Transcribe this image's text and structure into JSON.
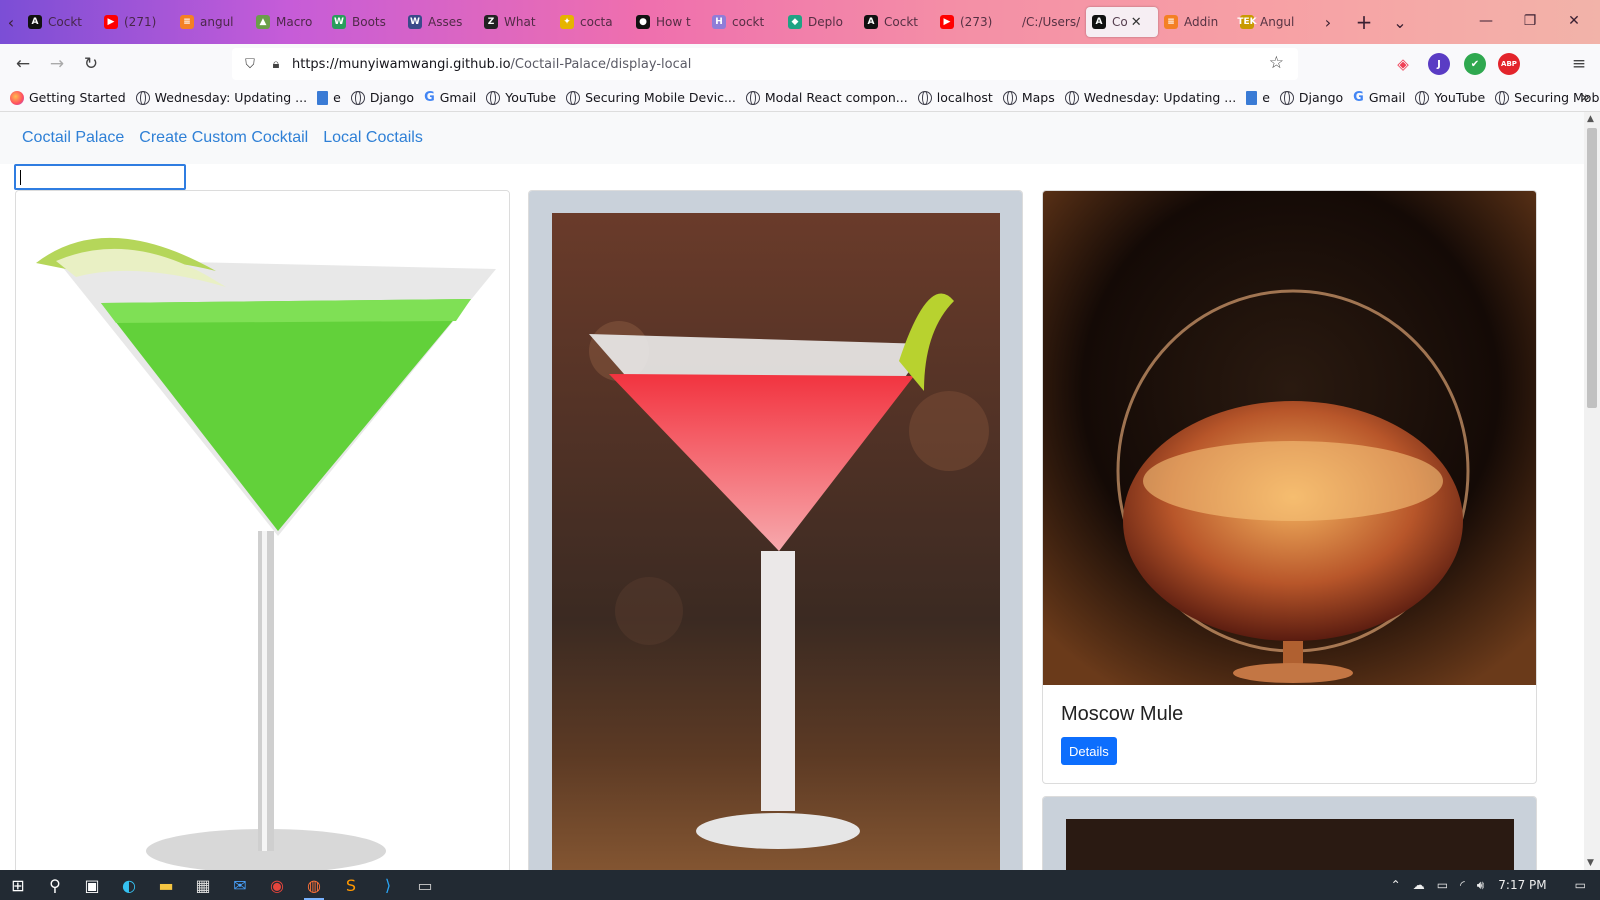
{
  "browser": {
    "tabs": [
      {
        "title": "Cockt",
        "fav": "A",
        "fav_color": "#111111"
      },
      {
        "title": "(271)",
        "fav": "▶",
        "fav_color": "#ff0000"
      },
      {
        "title": "angul",
        "fav": "≡",
        "fav_color": "#f48024"
      },
      {
        "title": "Macro",
        "fav": "▲",
        "fav_color": "#6b9e4a"
      },
      {
        "title": "Boots",
        "fav": "W",
        "fav_color": "#2a9d5c"
      },
      {
        "title": "Asses",
        "fav": "W",
        "fav_color": "#3a4a8a"
      },
      {
        "title": "What",
        "fav": "Z",
        "fav_color": "#222222"
      },
      {
        "title": "cocta",
        "fav": "✦",
        "fav_color": "#e6b400"
      },
      {
        "title": "How t",
        "fav": "●",
        "fav_color": "#111111"
      },
      {
        "title": "cockt",
        "fav": "H",
        "fav_color": "#8f7dd8"
      },
      {
        "title": "Deplo",
        "fav": "◆",
        "fav_color": "#1fa384"
      },
      {
        "title": "Cockt",
        "fav": "A",
        "fav_color": "#111111"
      },
      {
        "title": "(273)",
        "fav": "▶",
        "fav_color": "#ff0000"
      },
      {
        "title": "/C:/Users/",
        "fav": "",
        "fav_color": "transparent"
      },
      {
        "title": "Co",
        "fav": "A",
        "fav_color": "#111111",
        "active": true
      },
      {
        "title": "Addin",
        "fav": "≡",
        "fav_color": "#f48024"
      },
      {
        "title": "Angul",
        "fav": "TEK",
        "fav_color": "#c89a00"
      }
    ],
    "url_host": "https://munyiwamwangi.github.io",
    "url_path": "/Coctail-Palace/display-local",
    "bookmarks": [
      {
        "label": "Getting Started",
        "icon": "firefox-icon"
      },
      {
        "label": "Wednesday: Updating ...",
        "icon": "globe-icon"
      },
      {
        "label": "e",
        "icon": "doc-icon"
      },
      {
        "label": "Django",
        "icon": "globe-icon"
      },
      {
        "label": "Gmail",
        "icon": "google-icon"
      },
      {
        "label": "YouTube",
        "icon": "globe-icon"
      },
      {
        "label": "Securing Mobile Devic...",
        "icon": "globe-icon"
      },
      {
        "label": "Modal React compon...",
        "icon": "globe-icon"
      },
      {
        "label": "localhost",
        "icon": "globe-icon"
      },
      {
        "label": "Maps",
        "icon": "globe-icon"
      },
      {
        "label": "Wednesday: Updating ...",
        "icon": "globe-icon"
      },
      {
        "label": "e",
        "icon": "doc-icon"
      },
      {
        "label": "Django",
        "icon": "globe-icon"
      },
      {
        "label": "Gmail",
        "icon": "google-icon"
      },
      {
        "label": "YouTube",
        "icon": "globe-icon"
      },
      {
        "label": "Securing Mobile Devic...",
        "icon": "globe-icon"
      }
    ],
    "extensions": [
      {
        "name": "pocket-icon",
        "glyph": "◈",
        "color": "#ef4056"
      },
      {
        "name": "profile-avatar",
        "glyph": "J",
        "color": "#5a3cc4"
      },
      {
        "name": "shield-extension-icon",
        "glyph": "✔",
        "color": "#2fa84f"
      },
      {
        "name": "adblock-icon",
        "glyph": "ABP",
        "color": "#e3242b"
      }
    ]
  },
  "app": {
    "nav": {
      "brand": "Coctail Palace",
      "create": "Create Custom Cocktail",
      "local": "Local Coctails"
    },
    "search_value": "",
    "cards": [
      {
        "name": "",
        "image": "green-appletini-image"
      },
      {
        "name": "",
        "image": "red-cosmopolitan-image"
      },
      {
        "name": "Moscow Mule",
        "image": "brandy-snifter-image",
        "button": "Details"
      }
    ]
  },
  "taskbar": {
    "time": "7:17 PM",
    "apps": [
      "windows-start-icon",
      "search-icon",
      "task-view-icon",
      "edge-icon",
      "file-explorer-icon",
      "store-icon",
      "mail-icon",
      "chrome-icon",
      "firefox-icon",
      "sublime-icon",
      "vscode-icon",
      "terminal-icon"
    ]
  }
}
